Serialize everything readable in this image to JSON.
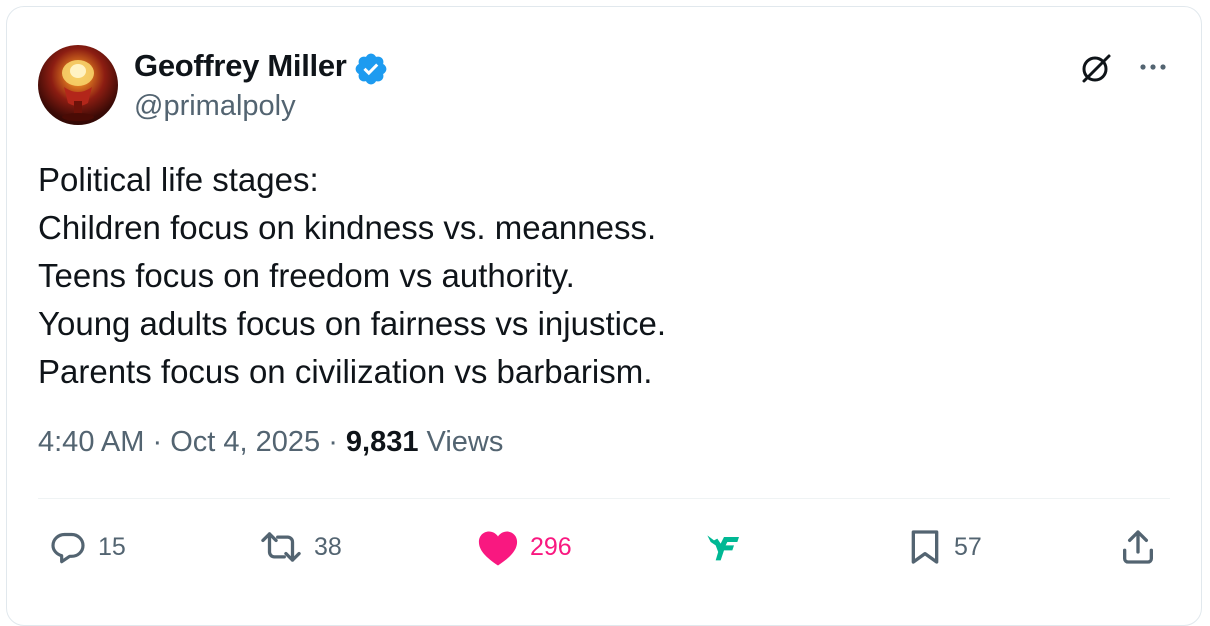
{
  "author": {
    "name": "Geoffrey Miller",
    "handle": "@primalpoly",
    "verified": true,
    "verified_color": "#1d9bf0"
  },
  "tweet": {
    "lines": [
      "Political life stages:",
      "Children focus on kindness vs. meanness.",
      "Teens focus on freedom vs authority.",
      "Young adults focus on fairness vs injustice.",
      "Parents focus on civilization vs barbarism."
    ]
  },
  "meta": {
    "time": "4:40 AM",
    "date": "Oct 4, 2025",
    "separator": "·",
    "views_count": "9,831",
    "views_label": "Views"
  },
  "actions": {
    "reply_count": "15",
    "repost_count": "38",
    "like_count": "296",
    "bookmark_count": "57"
  },
  "icons": {
    "header": [
      "grok-icon",
      "more-options-icon"
    ],
    "actions": [
      "reply-icon",
      "repost-icon",
      "heart-icon",
      "grok-logo-icon",
      "bookmark-icon",
      "share-icon"
    ]
  },
  "colors": {
    "text": "#0f1419",
    "secondary": "#536471",
    "like": "#f91880",
    "accent_green": "#00b894",
    "divider": "#eff3f4"
  }
}
